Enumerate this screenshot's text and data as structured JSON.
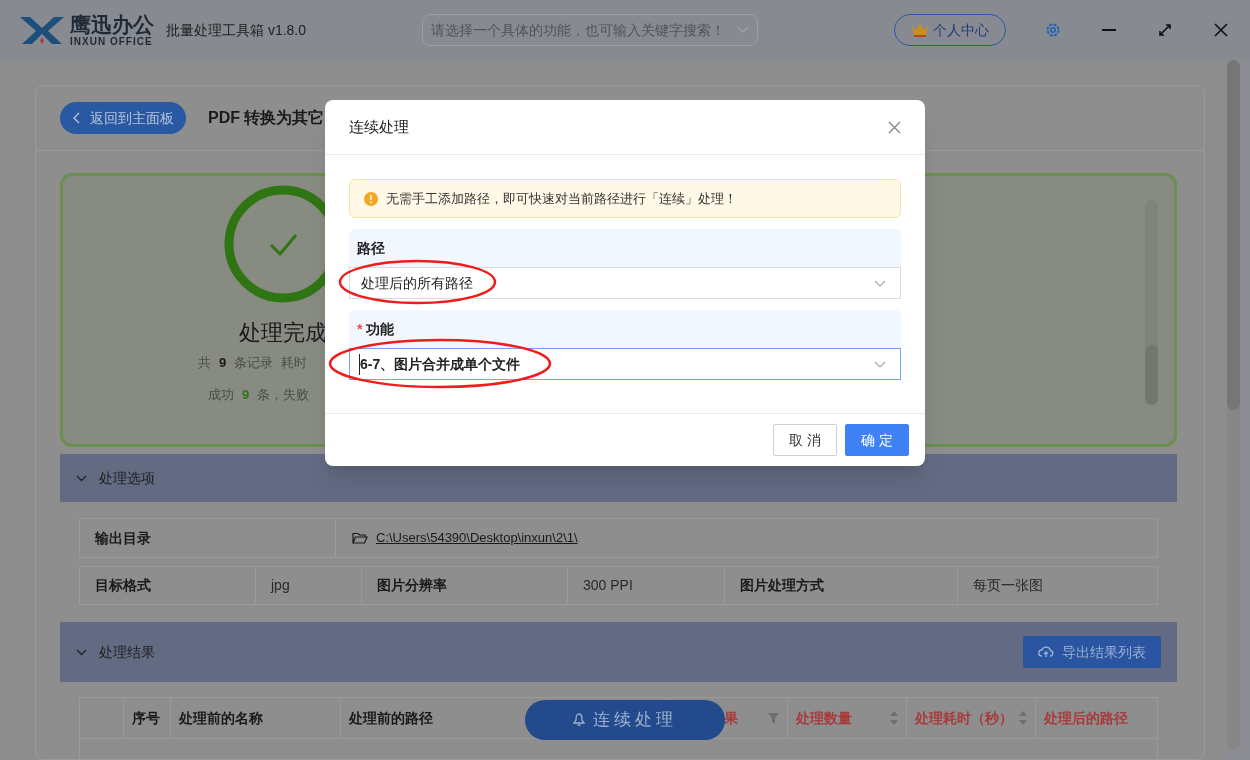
{
  "app": {
    "brand": "鹰迅办公",
    "brand_sub": "INXUN OFFICE",
    "title": "批量处理工具箱 v1.8.0",
    "search": {
      "placeholder": "请选择一个具体的功能，也可输入关键字搜索！"
    },
    "account_button": "个人中心"
  },
  "page": {
    "back_button": "返回到主面板",
    "title": "PDF 转换为其它"
  },
  "summary": {
    "status": "处理完成",
    "lines": [
      [
        {
          "text": "共",
          "kind": "plain"
        },
        {
          "text": "9",
          "kind": "count"
        },
        {
          "text": "条记录",
          "kind": "plain"
        },
        {
          "text": "耗时",
          "kind": "plain"
        }
      ],
      [
        {
          "text": "成功",
          "kind": "plain"
        },
        {
          "text": "9",
          "kind": "success"
        },
        {
          "text": "条，失败",
          "kind": "plain"
        }
      ]
    ]
  },
  "options": {
    "title": "处理选项",
    "expanded": true,
    "output_dir": {
      "label": "输出目录",
      "value": "C:\\Users\\54390\\Desktop\\inxun\\2\\1\\"
    },
    "fields": [
      {
        "label": "目标格式",
        "value": "jpg"
      },
      {
        "label": "图片分辨率",
        "value": "300 PPI"
      },
      {
        "label": "图片处理方式",
        "value": "每页一张图"
      }
    ]
  },
  "results": {
    "title": "处理结果",
    "expanded": true,
    "export_button": "导出结果列表",
    "columns": [
      {
        "label": "序号",
        "kind": "plain"
      },
      {
        "label": "处理前的名称",
        "kind": "plain"
      },
      {
        "label": "处理前的路径",
        "kind": "plain"
      },
      {
        "label": "果",
        "kind": "filter"
      },
      {
        "label": "处理数量",
        "kind": "sort"
      },
      {
        "label": "处理耗时（秒）",
        "kind": "sort"
      },
      {
        "label": "处理后的路径",
        "kind": "emph"
      }
    ]
  },
  "float_button": "连续处理",
  "dialog": {
    "title": "连续处理",
    "notice": "无需手工添加路径，即可快速对当前路径进行「连续」处理！",
    "fields": [
      {
        "label": "路径",
        "value": "处理后的所有路径",
        "focused": false,
        "circled": true
      },
      {
        "label": "功能",
        "value": "6-7、图片合并成单个文件",
        "required_mark": "*",
        "focused": true,
        "circled": true
      }
    ],
    "buttons": [
      {
        "label": "取 消",
        "kind": "secondary"
      },
      {
        "label": "确 定",
        "kind": "primary"
      }
    ]
  }
}
